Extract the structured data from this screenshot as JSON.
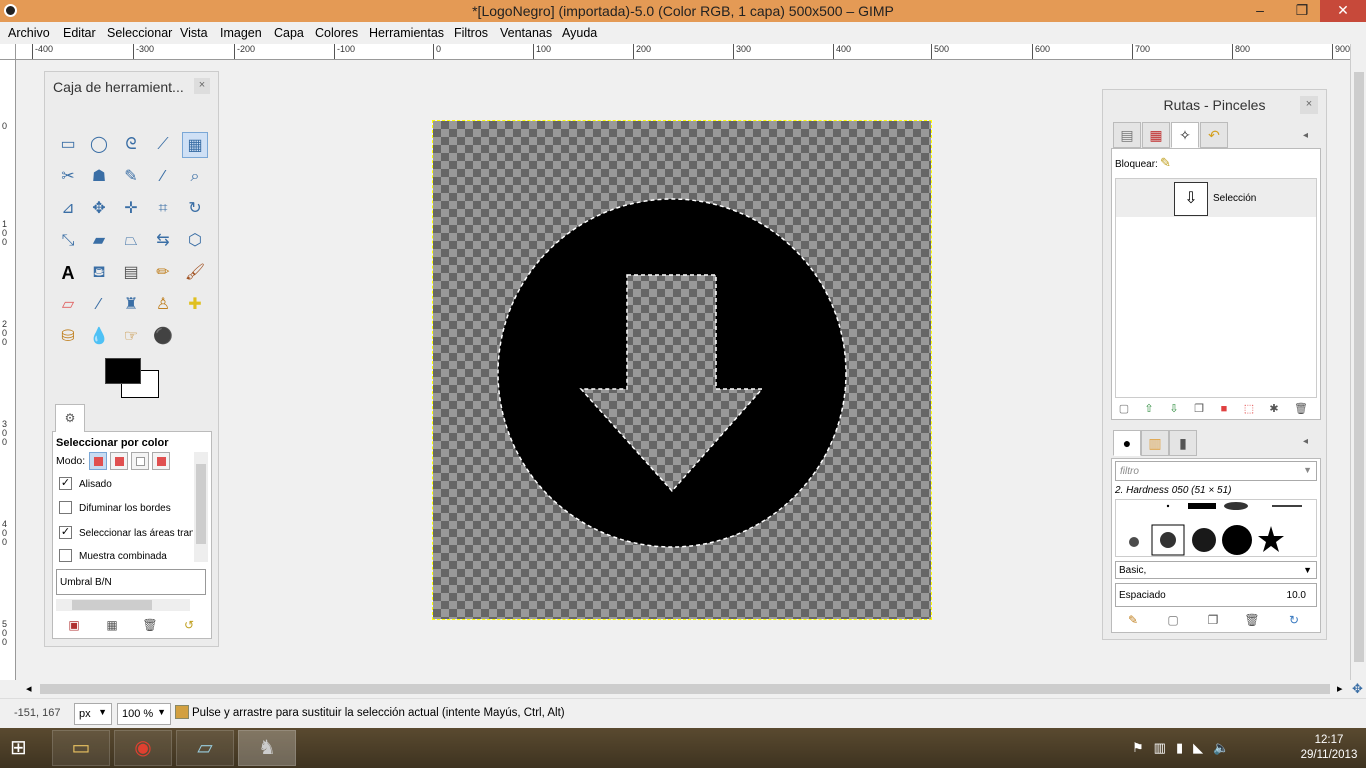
{
  "window": {
    "title": "*[LogoNegro] (importada)-5.0 (Color RGB, 1 capa) 500x500 – GIMP",
    "minimize": "–",
    "maximize": "❐",
    "close": "✕"
  },
  "menu": [
    "Archivo",
    "Editar",
    "Seleccionar",
    "Vista",
    "Imagen",
    "Capa",
    "Colores",
    "Herramientas",
    "Filtros",
    "Ventanas",
    "Ayuda"
  ],
  "ruler_h": [
    "-400",
    "-300",
    "-200",
    "-100",
    "0",
    "100",
    "200",
    "300",
    "400",
    "500",
    "600",
    "700",
    "800",
    "900"
  ],
  "ruler_v": [
    "0",
    "1 0 0",
    "2 0 0",
    "3 0 0",
    "4 0 0",
    "5 0 0"
  ],
  "toolbox": {
    "title": "Caja de herramient...",
    "close": "×",
    "options": {
      "heading": "Seleccionar por color",
      "mode_label": "Modo:",
      "checks": [
        {
          "label": "Alisado",
          "checked": true
        },
        {
          "label": "Difuminar los bordes",
          "checked": false
        },
        {
          "label": "Seleccionar las áreas transp",
          "checked": true
        },
        {
          "label": "Muestra combinada",
          "checked": false
        }
      ],
      "threshold_label": "Umbral B/N"
    }
  },
  "dock": {
    "title": "Rutas - Pinceles",
    "close": "×",
    "lock_label": "Bloquear:",
    "path_name": "Selección",
    "brush_filter_placeholder": "filtro",
    "brush_name": "2. Hardness 050 (51 × 51)",
    "brush_preset": "Basic,",
    "spacing_label": "Espaciado",
    "spacing_value": "10.0"
  },
  "status": {
    "coords": "-151, 167",
    "unit": "px",
    "zoom": "100 %",
    "message": "Pulse y arrastre para sustituir la selección actual (intente Mayús, Ctrl, Alt)"
  },
  "taskbar": {
    "time": "12:17",
    "date": "29/11/2013"
  },
  "colors": {
    "titlebar": "#e49a55",
    "close": "#c7493a",
    "foreground": "#000000",
    "background": "#ffffff"
  }
}
